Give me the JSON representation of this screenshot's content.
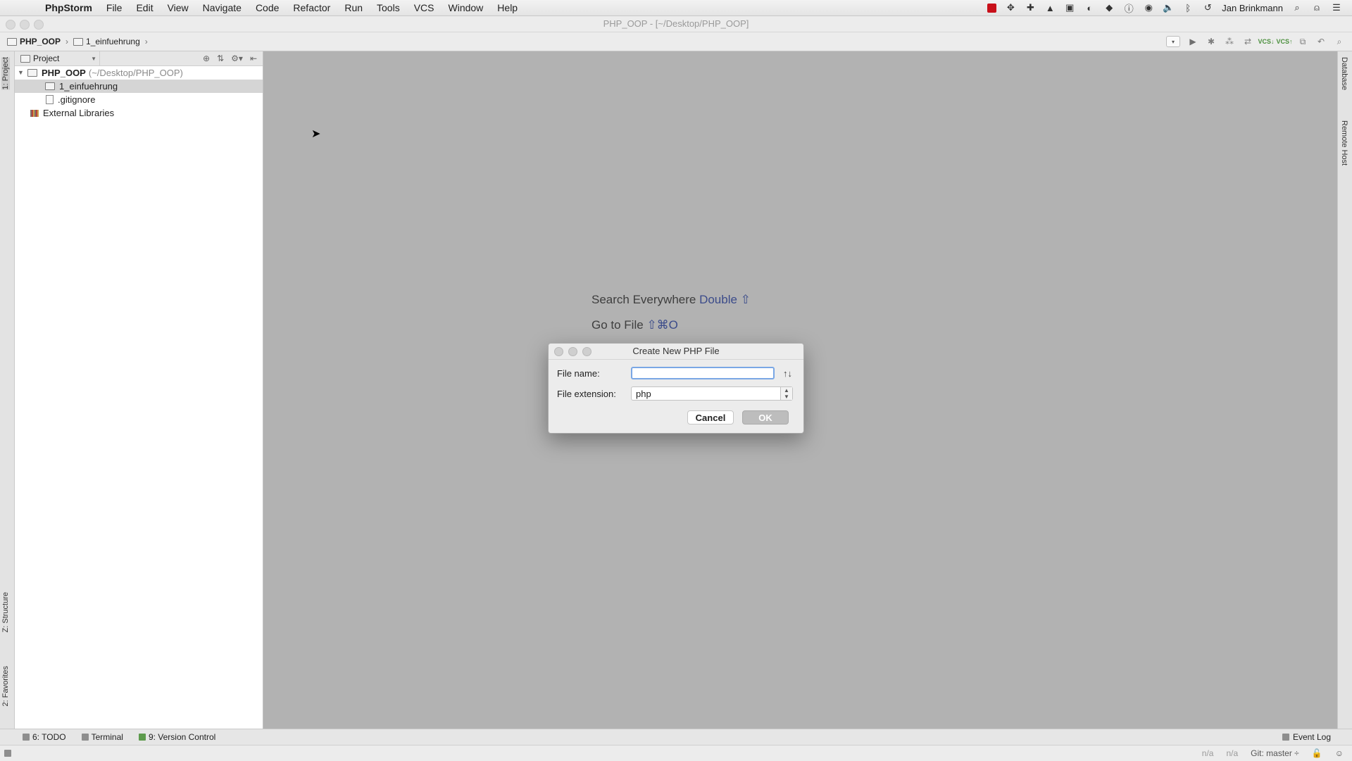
{
  "menubar": {
    "apple_glyph": "",
    "app_name": "PhpStorm",
    "items": [
      "File",
      "Edit",
      "View",
      "Navigate",
      "Code",
      "Refactor",
      "Run",
      "Tools",
      "VCS",
      "Window",
      "Help"
    ],
    "user": "Jan Brinkmann"
  },
  "window": {
    "title": "PHP_OOP - [~/Desktop/PHP_OOP]"
  },
  "breadcrumb": {
    "project": "PHP_OOP",
    "folder": "1_einfuehrung"
  },
  "left_stripe": {
    "project_tab": "1: Project",
    "structure_tab": "Z: Structure",
    "favorites_tab": "2: Favorites"
  },
  "right_stripe": {
    "database_tab": "Database",
    "remote_host_tab": "Remote Host"
  },
  "project_panel": {
    "view_mode": "Project",
    "tree": {
      "root_name": "PHP_OOP",
      "root_path": "(~/Desktop/PHP_OOP)",
      "folder": "1_einfuehrung",
      "file": ".gitignore",
      "libraries": "External Libraries"
    }
  },
  "editor": {
    "hint_search_label": "Search Everywhere",
    "hint_search_key": "Double ⇧",
    "hint_goto_label": "Go to File",
    "hint_goto_key": "⇧⌘O"
  },
  "dialog": {
    "title": "Create New PHP File",
    "file_name_label": "File name:",
    "file_name_value": "",
    "file_extension_label": "File extension:",
    "file_extension_value": "php",
    "cancel_label": "Cancel",
    "ok_label": "OK"
  },
  "bottom_bar": {
    "todo": "6: TODO",
    "terminal": "Terminal",
    "version_control": "9: Version Control",
    "event_log": "Event Log"
  },
  "status_bar": {
    "pos1": "n/a",
    "pos2": "n/a",
    "git_branch": "Git: master ÷"
  },
  "colors": {
    "editor_bg": "#b2b2b2",
    "hint_key": "#3b4b8a",
    "input_focus": "#7aa7e5"
  }
}
